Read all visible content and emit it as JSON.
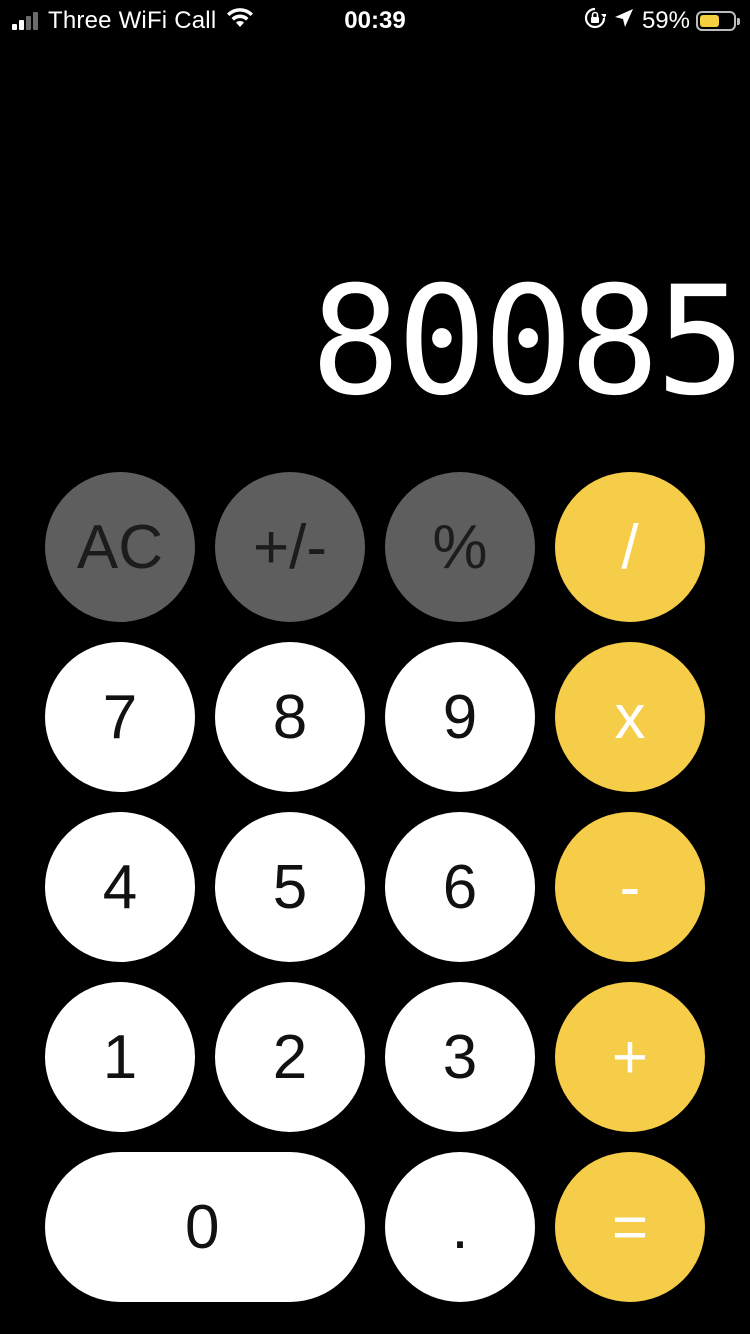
{
  "status_bar": {
    "carrier": "Three WiFi Call",
    "time": "00:39",
    "battery_percent": "59%",
    "battery_level": 0.59,
    "signal_bars_on": 2,
    "signal_bars_total": 4
  },
  "display": {
    "value": "80085"
  },
  "keys": {
    "ac": "AC",
    "sign": "+/-",
    "percent": "%",
    "divide": "/",
    "multiply": "x",
    "subtract": "-",
    "add": "+",
    "equals": "=",
    "decimal": ".",
    "d0": "0",
    "d1": "1",
    "d2": "2",
    "d3": "3",
    "d4": "4",
    "d5": "5",
    "d6": "6",
    "d7": "7",
    "d8": "8",
    "d9": "9"
  },
  "colors": {
    "background": "#000000",
    "function_key": "#5e5e5e",
    "digit_key": "#ffffff",
    "operator_key": "#f6cd48",
    "battery_fill": "#f4cf3f"
  }
}
